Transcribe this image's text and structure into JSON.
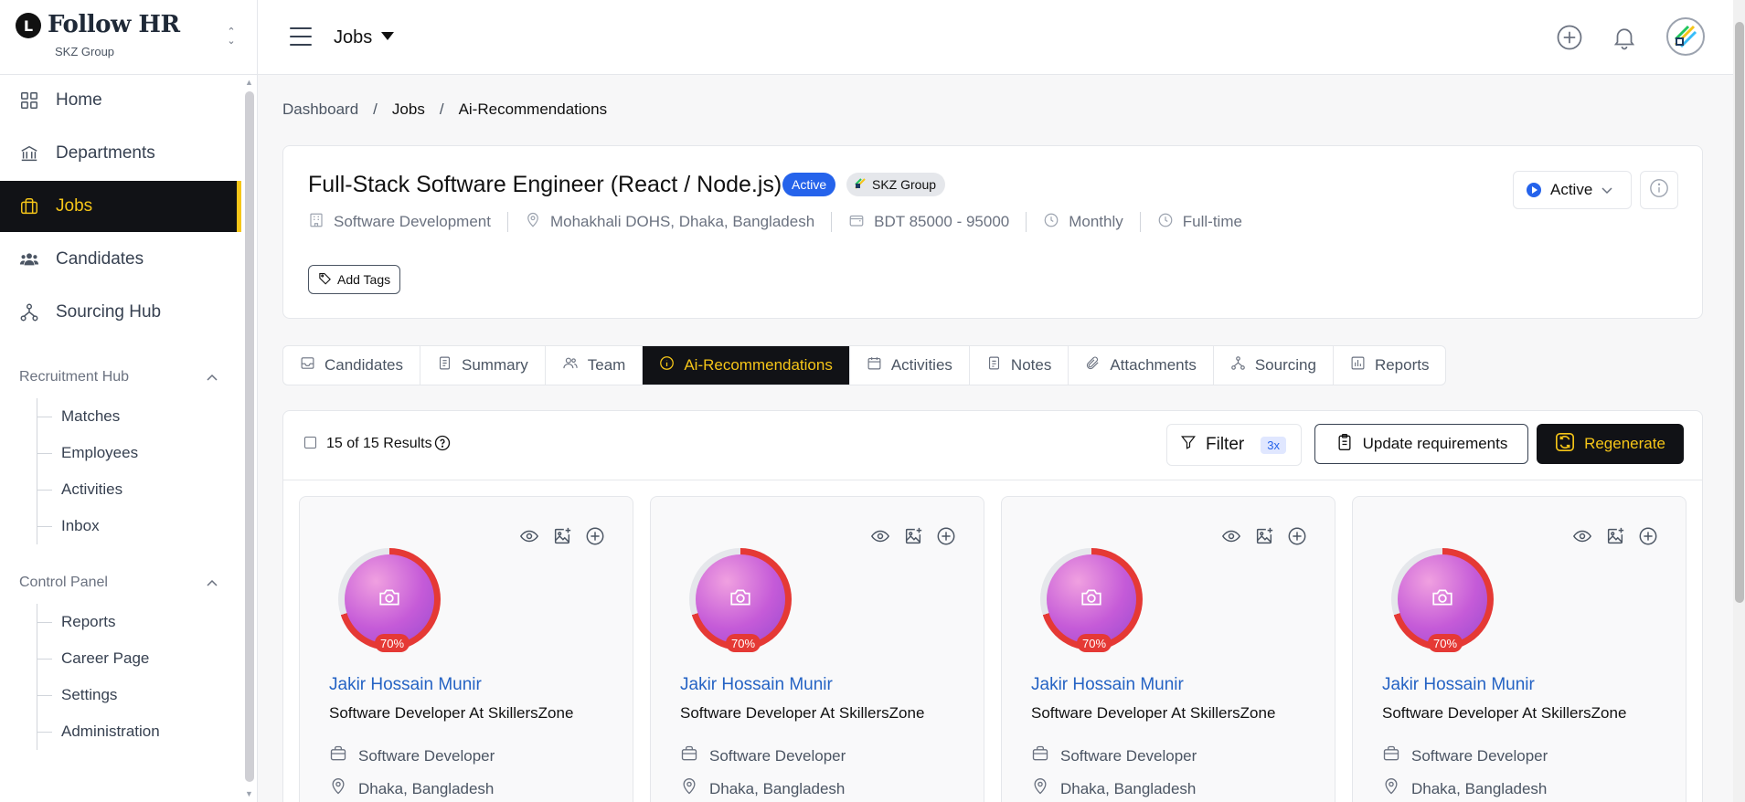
{
  "brand": {
    "name": "Follow HR",
    "logo_letter": "L",
    "org": "SKZ Group"
  },
  "sidebar": {
    "items": [
      {
        "label": "Home",
        "icon": "grid-icon"
      },
      {
        "label": "Departments",
        "icon": "bank-icon"
      },
      {
        "label": "Jobs",
        "icon": "briefcase-icon",
        "active": true
      },
      {
        "label": "Candidates",
        "icon": "users-icon"
      },
      {
        "label": "Sourcing Hub",
        "icon": "network-icon"
      }
    ],
    "sections": [
      {
        "title": "Recruitment Hub",
        "items": [
          "Matches",
          "Employees",
          "Activities",
          "Inbox"
        ]
      },
      {
        "title": "Control Panel",
        "items": [
          "Reports",
          "Career Page",
          "Settings",
          "Administration"
        ]
      }
    ]
  },
  "topbar": {
    "title": "Jobs"
  },
  "breadcrumb": {
    "items": [
      "Dashboard",
      "Jobs",
      "Ai-Recommendations"
    ],
    "separator": "/"
  },
  "job": {
    "title": "Full-Stack Software Engineer (React / Node.js)",
    "status_badge": "Active",
    "org_badge": "SKZ Group",
    "department": "Software Development",
    "location": "Mohakhali DOHS, Dhaka, Bangladesh",
    "salary": "BDT 85000 - 95000",
    "pay_period": "Monthly",
    "employment_type": "Full-time",
    "add_tags_label": "Add Tags",
    "status_select": "Active"
  },
  "tabs": [
    {
      "label": "Candidates",
      "icon": "inbox-icon"
    },
    {
      "label": "Summary",
      "icon": "document-icon"
    },
    {
      "label": "Team",
      "icon": "users-icon"
    },
    {
      "label": "Ai-Recommendations",
      "icon": "info-icon",
      "active": true
    },
    {
      "label": "Activities",
      "icon": "calendar-icon"
    },
    {
      "label": "Notes",
      "icon": "note-icon"
    },
    {
      "label": "Attachments",
      "icon": "paperclip-icon"
    },
    {
      "label": "Sourcing",
      "icon": "network-icon"
    },
    {
      "label": "Reports",
      "icon": "chart-icon"
    }
  ],
  "results": {
    "count_text": "15 of 15 Results",
    "filter_label": "Filter",
    "filter_count": "3x",
    "update_label": "Update requirements",
    "regenerate_label": "Regenerate"
  },
  "candidates": [
    {
      "name": "Jakir Hossain Munir",
      "headline": "Software Developer At SkillersZone",
      "role": "Software Developer",
      "location": "Dhaka, Bangladesh",
      "match": "70%",
      "match_value": 0.7
    },
    {
      "name": "Jakir Hossain Munir",
      "headline": "Software Developer At SkillersZone",
      "role": "Software Developer",
      "location": "Dhaka, Bangladesh",
      "match": "70%",
      "match_value": 0.7
    },
    {
      "name": "Jakir Hossain Munir",
      "headline": "Software Developer At SkillersZone",
      "role": "Software Developer",
      "location": "Dhaka, Bangladesh",
      "match": "70%",
      "match_value": 0.7
    },
    {
      "name": "Jakir Hossain Munir",
      "headline": "Software Developer At SkillersZone",
      "role": "Software Developer",
      "location": "Dhaka, Bangladesh",
      "match": "70%",
      "match_value": 0.7
    }
  ],
  "colors": {
    "accent": "#f5c518",
    "dark": "#111216",
    "link": "#2563c4",
    "badge_blue": "#2563eb",
    "match_red": "#e53935"
  }
}
